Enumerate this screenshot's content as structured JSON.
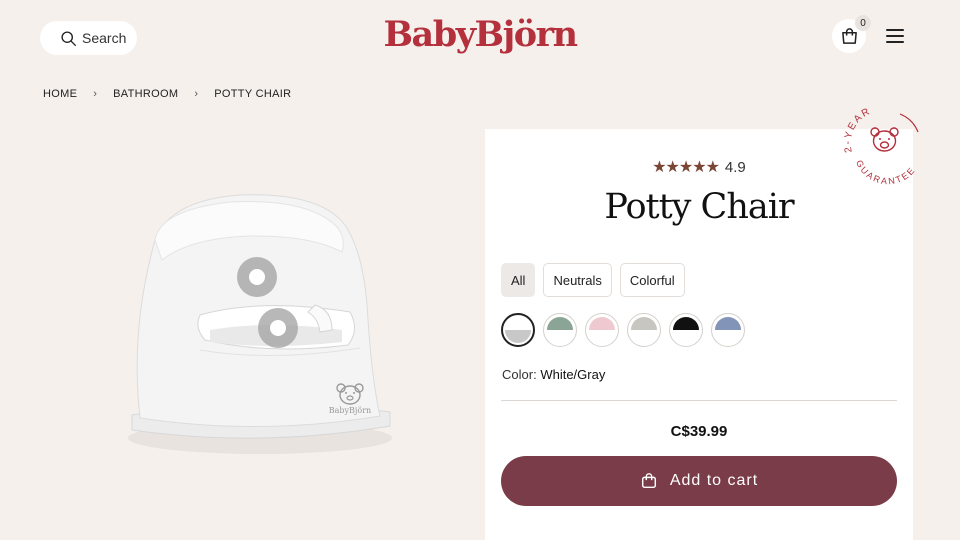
{
  "header": {
    "search_label": "Search",
    "logo_text": "BabyBjörn",
    "cart_count": "0"
  },
  "breadcrumb": {
    "items": [
      "HOME",
      "BATHROOM",
      "POTTY CHAIR"
    ]
  },
  "product": {
    "stars": "★★★★★",
    "rating": "4.9",
    "title": "Potty Chair",
    "filters": [
      "All",
      "Neutrals",
      "Colorful"
    ],
    "color_label": "Color:",
    "color_value": "White/Gray",
    "price": "C$39.99",
    "add_to_cart": "Add to cart",
    "image_logo": "BabyBjörn"
  },
  "badge": {
    "top_text": "2-YEAR",
    "bottom_text": "GUARANTEE"
  },
  "colors": {
    "brand": "#b3303c",
    "button": "#7a3c48",
    "background": "#f6f0ec",
    "swatches": [
      [
        "#ffffff",
        "#c8c8c8"
      ],
      [
        "#8aa596",
        "#ffffff"
      ],
      [
        "#efc9d0",
        "#ffffff"
      ],
      [
        "#c8c6c0",
        "#ffffff"
      ],
      [
        "#111111",
        "#ffffff"
      ],
      [
        "#8294b8",
        "#ffffff"
      ]
    ]
  }
}
